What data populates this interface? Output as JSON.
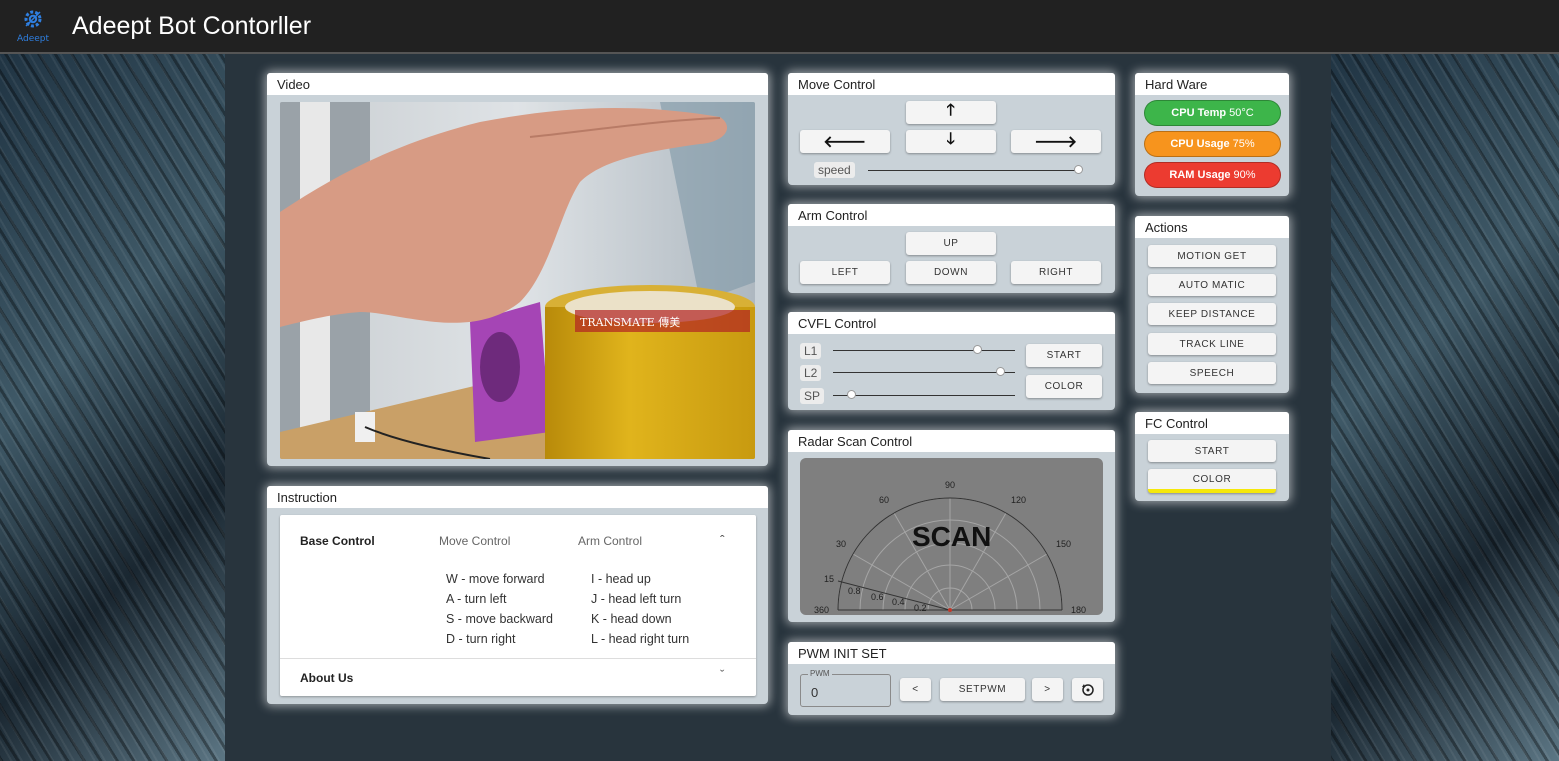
{
  "app": {
    "title": "Adeept Bot Contorller",
    "logo_text": "Adeept",
    "logo_icon": "adeept-gear-logo-icon"
  },
  "colors": {
    "topbar": "#212121",
    "card": "#c9d2d8",
    "green": "#3db54a",
    "orange": "#f7941d",
    "red": "#ec3b30",
    "accent_yellow": "#f5e80a"
  },
  "video": {
    "title": "Video"
  },
  "move_control": {
    "title": "Move Control",
    "up": "🡑",
    "left": "🡐",
    "down": "🡓",
    "right": "🡒",
    "speed_label": "speed",
    "speed_value": 1.0
  },
  "arm_control": {
    "title": "Arm Control",
    "up": "UP",
    "left": "LEFT",
    "down": "DOWN",
    "right": "RIGHT"
  },
  "cvfl_control": {
    "title": "CVFL Control",
    "sliders": [
      {
        "label": "L1",
        "value": 0.8
      },
      {
        "label": "L2",
        "value": 0.92
      },
      {
        "label": "SP",
        "value": 0.1
      }
    ],
    "start": "START",
    "color": "COLOR"
  },
  "radar": {
    "title": "Radar Scan Control",
    "scan_label": "SCAN",
    "angle_labels": [
      "90",
      "60",
      "120",
      "30",
      "150",
      "15",
      "360",
      "180"
    ],
    "radius_labels": [
      "0.8",
      "0.6",
      "0.4",
      "0.2"
    ]
  },
  "pwm": {
    "title": "PWM INIT SET",
    "field_label": "PWM",
    "field_value": "0",
    "prev": "<",
    "set": "SETPWM",
    "next": ">",
    "reset_icon": "reset-icon"
  },
  "hardware": {
    "title": "Hard Ware",
    "cpu_temp_label": "CPU Temp",
    "cpu_temp_value": "50°C",
    "cpu_usage_label": "CPU Usage",
    "cpu_usage_value": "75%",
    "ram_usage_label": "RAM Usage",
    "ram_usage_value": "90%"
  },
  "actions": {
    "title": "Actions",
    "items": [
      "MOTION GET",
      "AUTO MATIC",
      "KEEP DISTANCE",
      "TRACK LINE",
      "SPEECH"
    ]
  },
  "fc_control": {
    "title": "FC Control",
    "start": "START",
    "color": "COLOR"
  },
  "instruction": {
    "title": "Instruction",
    "tabs": [
      "Base Control",
      "Move Control",
      "Arm Control"
    ],
    "move_lines": [
      "W - move forward",
      "A - turn left",
      "S - move backward",
      "D - turn right"
    ],
    "arm_lines": [
      "I - head up",
      "J - head left turn",
      "K - head down",
      "L - head right turn"
    ],
    "about": "About Us"
  }
}
